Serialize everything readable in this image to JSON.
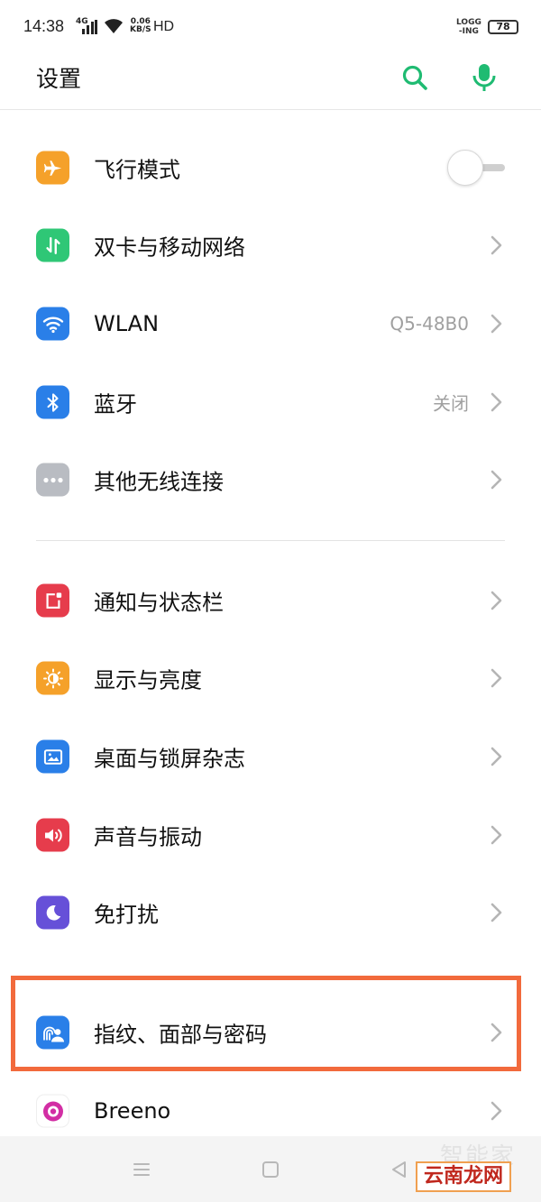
{
  "status_bar": {
    "time": "14:38",
    "network_type": "4G",
    "speed_value": "0.06",
    "speed_unit": "KB/S",
    "hd_label": "HD",
    "logging_line1": "LOGG",
    "logging_line2": "-ING",
    "battery": "78"
  },
  "header": {
    "title": "设置",
    "search_icon": "search-icon",
    "mic_icon": "mic-icon",
    "accent_color": "#1fbb72"
  },
  "group1": [
    {
      "label": "飞行模式",
      "icon": "airplane-icon",
      "icon_color": "#f5a12a",
      "control": "toggle",
      "toggle_on": false
    },
    {
      "label": "双卡与移动网络",
      "icon": "sim-data-icon",
      "icon_color": "#2fc776",
      "control": "chevron"
    },
    {
      "label": "WLAN",
      "icon": "wifi-icon",
      "icon_color": "#2a7fe8",
      "value": "Q5-48B0",
      "control": "chevron"
    },
    {
      "label": "蓝牙",
      "icon": "bluetooth-icon",
      "icon_color": "#2a7fe8",
      "value": "关闭",
      "control": "chevron"
    },
    {
      "label": "其他无线连接",
      "icon": "more-icon",
      "icon_color": "#b9bcc2",
      "control": "chevron"
    }
  ],
  "group2": [
    {
      "label": "通知与状态栏",
      "icon": "notification-icon",
      "icon_color": "#e63c4c",
      "control": "chevron"
    },
    {
      "label": "显示与亮度",
      "icon": "brightness-icon",
      "icon_color": "#f5a12a",
      "control": "chevron"
    },
    {
      "label": "桌面与锁屏杂志",
      "icon": "wallpaper-icon",
      "icon_color": "#2a7fe8",
      "control": "chevron"
    },
    {
      "label": "声音与振动",
      "icon": "speaker-icon",
      "icon_color": "#e63c4c",
      "control": "chevron"
    },
    {
      "label": "免打扰",
      "icon": "moon-icon",
      "icon_color": "#6650d8",
      "control": "chevron"
    }
  ],
  "group3": [
    {
      "label": "指纹、面部与密码",
      "icon": "fingerprint-face-icon",
      "icon_color": "#2a7fe8",
      "control": "chevron",
      "highlighted": true
    },
    {
      "label": "Breeno",
      "icon": "breeno-icon",
      "icon_color": "#d22ea4",
      "control": "chevron"
    }
  ],
  "highlight_color": "#f26a3c",
  "watermark": {
    "faint_text": "智能家",
    "text": "云南龙网"
  }
}
